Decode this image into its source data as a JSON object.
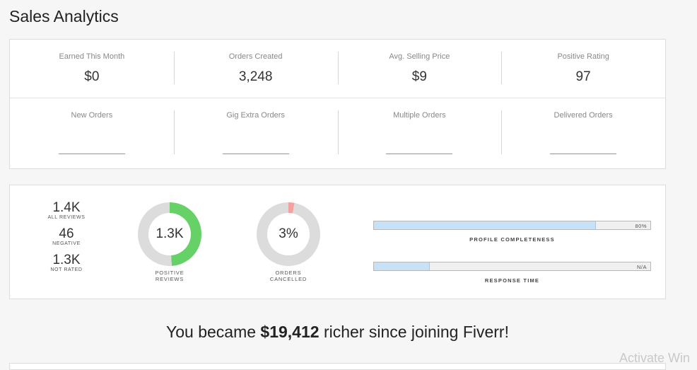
{
  "page": {
    "title": "Sales Analytics"
  },
  "stats": {
    "row1": [
      {
        "label": "Earned This Month",
        "value": "$0"
      },
      {
        "label": "Orders Created",
        "value": "3,248"
      },
      {
        "label": "Avg. Selling Price",
        "value": "$9"
      },
      {
        "label": "Positive Rating",
        "value": "97"
      }
    ],
    "row2": [
      {
        "label": "New Orders"
      },
      {
        "label": "Gig Extra Orders"
      },
      {
        "label": "Multiple Orders"
      },
      {
        "label": "Delivered Orders"
      }
    ]
  },
  "reviews": {
    "all": {
      "value": "1.4K",
      "label": "ALL REVIEWS"
    },
    "negative": {
      "value": "46",
      "label": "NEGATIVE"
    },
    "not_rated": {
      "value": "1.3K",
      "label": "NOT RATED"
    }
  },
  "donuts": {
    "positive": {
      "value": "1.3K",
      "caption_line1": "POSITIVE",
      "caption_line2": "REVIEWS",
      "fill_fraction": 0.49,
      "color": "#66d166"
    },
    "cancelled": {
      "value": "3%",
      "caption_line1": "ORDERS",
      "caption_line2": "CANCELLED",
      "fill_fraction": 0.03,
      "color": "#f3a0a0"
    }
  },
  "bars": {
    "profile": {
      "value": "80%",
      "label": "PROFILE COMPLETENESS",
      "fill_fraction": 0.8
    },
    "response": {
      "value": "N/A",
      "label": "RESPONSE TIME",
      "fill_fraction": 0.2
    }
  },
  "summary": {
    "prefix": "You became ",
    "amount": "$19,412",
    "suffix": " richer since joining Fiverr!"
  },
  "watermark": {
    "text": "Activate Win"
  },
  "colors": {
    "track": "#dcdcdc",
    "link": "#6a9fd6",
    "bar_fill": "#c7e2f7"
  }
}
